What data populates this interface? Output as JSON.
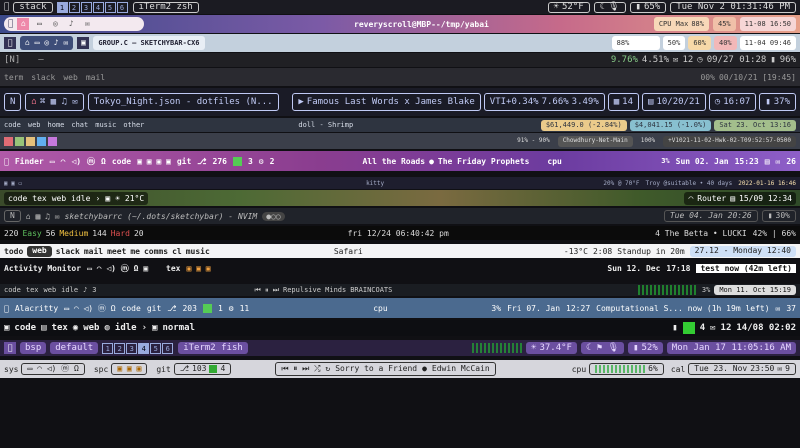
{
  "bar1": {
    "space": "stack",
    "ws": [
      "1",
      "2",
      "3",
      "4",
      "5",
      "6"
    ],
    "app": "iTerm2 zsh",
    "temp": "52°F",
    "battery": "65%",
    "clock": "Tue Nov 2 01:31:46 PM"
  },
  "bar2": {
    "title": "reveryscroll@MBP--/tmp/yabai",
    "cpu_label": "CPU Max",
    "cpu_val": "88%",
    "mem": "45%",
    "date": "11-08 16:50"
  },
  "bar3": {
    "path": "GROUP.C — SKETCHYBAR-CX6",
    "m1": "88%",
    "m2": "50%",
    "m3": "60%",
    "m4": "40%",
    "time": "11-04 09:46"
  },
  "bar4": {
    "label": "[N]",
    "dash": "—",
    "stat1": "9.76%",
    "stat2": "4.51%",
    "stat3": "12",
    "date": "09/27 01:28",
    "pct": "96%"
  },
  "bar5": {
    "items": [
      "term",
      "slack",
      "web",
      "mail"
    ],
    "right1": "00%",
    "right2": "00/10/21 [19:45]"
  },
  "bar6": {
    "mode": "N",
    "file": "Tokyo_Night.json - dotfiles (N...",
    "song": "Famous Last Words x James Blake",
    "vti": "VTI+0.34%",
    "s1": "7.66%",
    "s2": "3.49%",
    "n": "14",
    "date": "10/20/21",
    "time": "16:07",
    "bat": "37%"
  },
  "bar7": {
    "items": [
      "code",
      "web",
      "home",
      "chat",
      "music",
      "other"
    ],
    "middle": "doll - Shrimp",
    "price1": "$61,449.0 (-2.84%)",
    "price2": "$4,041.15 (-1.0%)",
    "date": "Sat 23. Oct 13:16"
  },
  "bar8": {
    "stat": "91% - 90%",
    "city": "Chowdhury-Net-Main",
    "bat": "100%",
    "clock": "+V1021-11-02-Hwk-02-T09:52:57-0500"
  },
  "bar9": {
    "app": "Finder",
    "code": "code",
    "git": "git",
    "n1": "276",
    "n2": "3",
    "n3": "2",
    "song": "All the Roads",
    "artist": "The Friday Prophets",
    "cpu": "cpu",
    "cpu_pct": "3%",
    "date": "Sun 02. Jan",
    "time": "15:23",
    "mail": "26"
  },
  "bar10": {
    "center": "kitty",
    "r1": "20% @ 70°F",
    "r2": "Troy @suitable • 40 days",
    "r3": "2022-01-16 16:46"
  },
  "bar11": {
    "items": [
      "code",
      "tex",
      "web",
      "idle"
    ],
    "temp": "21°C",
    "router": "Router",
    "date": "15/09 12:34"
  },
  "bar12": {
    "title": "sketchybarrc (~/.dots/sketchybar) - NVIM",
    "date": "Tue 04. Jan 20:26",
    "pct": "30%"
  },
  "bar13": {
    "total": "220",
    "easy": "Easy",
    "easy_n": "56",
    "med": "Medium",
    "med_n": "144",
    "hard": "Hard",
    "hard_n": "20",
    "center": "fri 12/24 06:40:42 pm",
    "song": "4  The Betta • LUCKI",
    "right": "42% | 66%"
  },
  "bar14": {
    "items": [
      "todo",
      "web",
      "slack",
      "mail",
      "meet",
      "me",
      "comms",
      "cl",
      "music"
    ],
    "app": "Safari",
    "temp": "-13°C",
    "time": "2:08",
    "standup": "Standup in 20m",
    "date": "27.12 - Monday 12:40"
  },
  "bar15": {
    "app": "Activity Monitor",
    "tex": "tex",
    "date": "Sun 12. Dec",
    "time": "17:18",
    "note": "test now (42m left)"
  },
  "bar16": {
    "items": [
      "code",
      "tex",
      "web",
      "idle"
    ],
    "n": "3",
    "song": "Repulsive Minds",
    "artist": "BRAINCOATS",
    "cpu": "3%",
    "date": "Mon 11. Oct 15:19"
  },
  "bar17": {
    "app": "Alacritty",
    "code": "code",
    "git": "git",
    "n1": "203",
    "n2": "1",
    "n3": "11",
    "cpu": "cpu",
    "cpu_pct": "3%",
    "date": "Fri 07. Jan",
    "time": "12:27",
    "note": "Computational S... now (1h 19m left)",
    "mail": "37"
  },
  "bar18": {
    "items": [
      "code",
      "tex",
      "web",
      "idle"
    ],
    "mode": "normal",
    "n1": "4",
    "n2": "12",
    "date": "14/08 02:02"
  },
  "bar19": {
    "space": "bsp",
    "layout": "default",
    "ws": [
      "1",
      "2",
      "3",
      "4",
      "5",
      "6"
    ],
    "app": "iTerm2 fish",
    "temp": "37.4°F",
    "bat": "52%",
    "clock": "Mon Jan 17 11:05:16 AM"
  },
  "bar20": {
    "sys": "sys",
    "spc": "spc",
    "git": "git",
    "n1": "103",
    "n2": "4",
    "song": "Sorry to a Friend",
    "artist": "Edwin McCain",
    "cpu": "cpu",
    "cpu_pct": "6%",
    "cal": "cal",
    "date": "Tue 23. Nov",
    "time": "23:50",
    "mail": "9"
  }
}
